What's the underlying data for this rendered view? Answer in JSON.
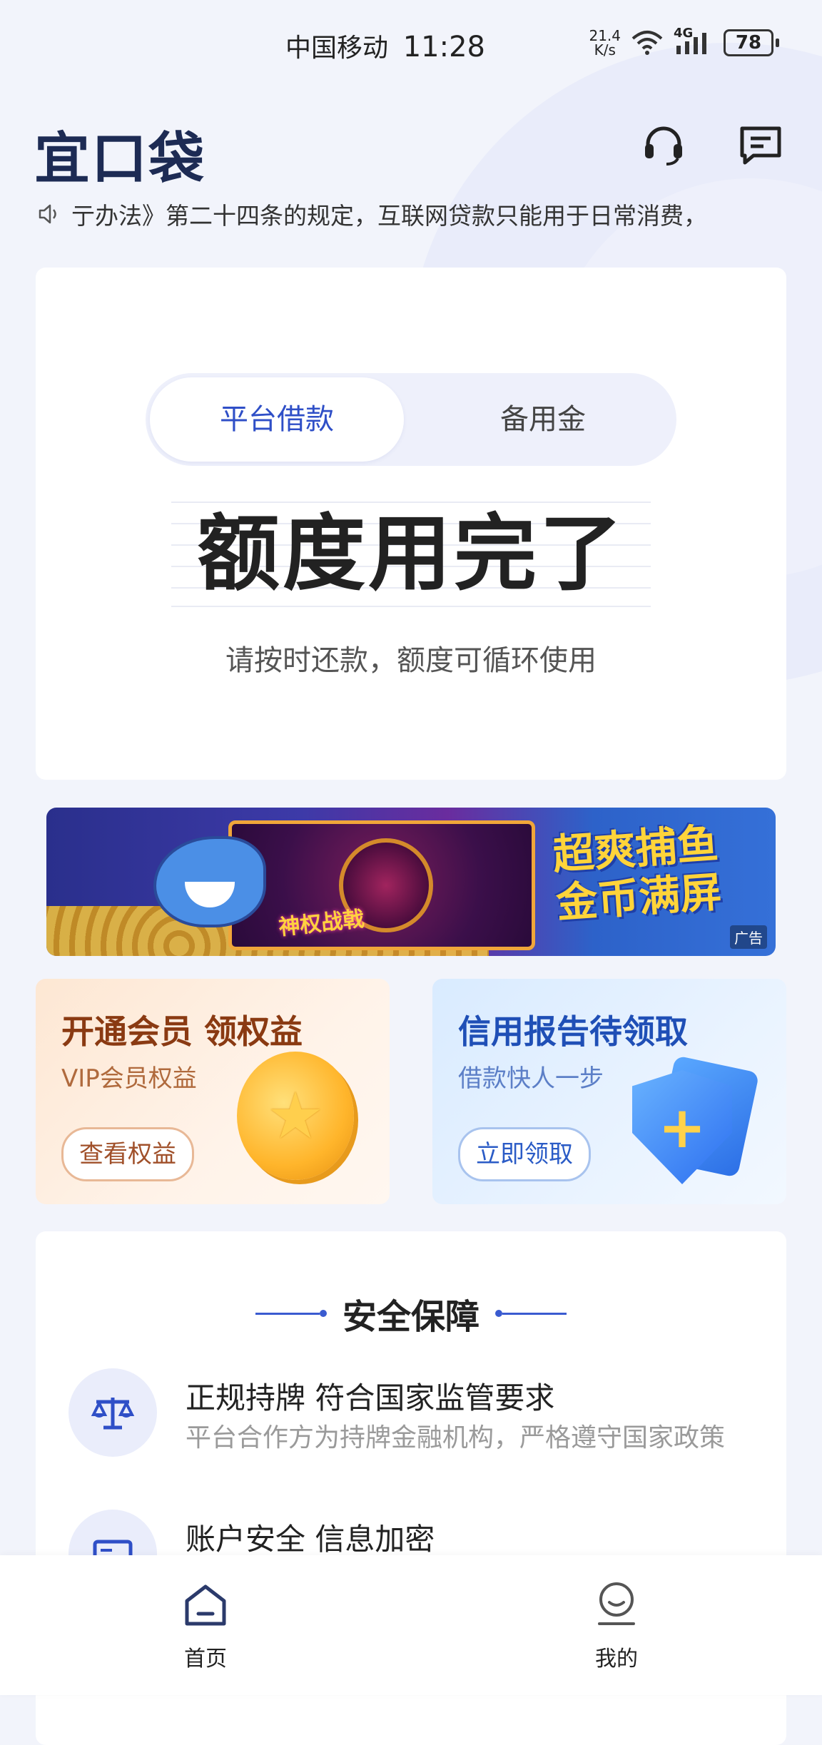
{
  "status_bar": {
    "carrier": "中国移动",
    "time": "11:28",
    "net_speed_value": "21.4",
    "net_speed_unit": "K/s",
    "network": "4G",
    "battery": "78"
  },
  "header": {
    "logo": "宜口袋",
    "icons": [
      "headset-icon",
      "message-icon"
    ]
  },
  "notice": {
    "text": "亍办法》第二十四条的规定，互联网贷款只能用于日常消费，"
  },
  "credit_card": {
    "tabs": [
      "平台借款",
      "备用金"
    ],
    "active_tab": 0,
    "headline": "额度用完了",
    "subline": "请按时还款，额度可循环使用"
  },
  "ad_banner": {
    "slogan": "神权战戟",
    "title_line1": "超爽捕鱼",
    "title_line2": "金币满屏",
    "tag": "广告"
  },
  "promo_cards": [
    {
      "title": "开通会员 领权益",
      "subtitle": "VIP会员权益",
      "button": "查看权益"
    },
    {
      "title": "信用报告待领取",
      "subtitle": "借款快人一步",
      "button": "立即领取"
    }
  ],
  "security": {
    "title": "安全保障",
    "items": [
      {
        "title": "正规持牌 符合国家监管要求",
        "desc": "平台合作方为持牌金融机构，严格遵守国家政策"
      },
      {
        "title": "账户安全 信息加密",
        "desc": ""
      }
    ]
  },
  "bottom_nav": {
    "items": [
      {
        "label": "首页",
        "icon": "home-icon",
        "active": true
      },
      {
        "label": "我的",
        "icon": "profile-icon",
        "active": false
      }
    ]
  },
  "colors": {
    "accent": "#2f4fc7",
    "logo": "#1d2b54",
    "background": "#f2f4fb"
  }
}
